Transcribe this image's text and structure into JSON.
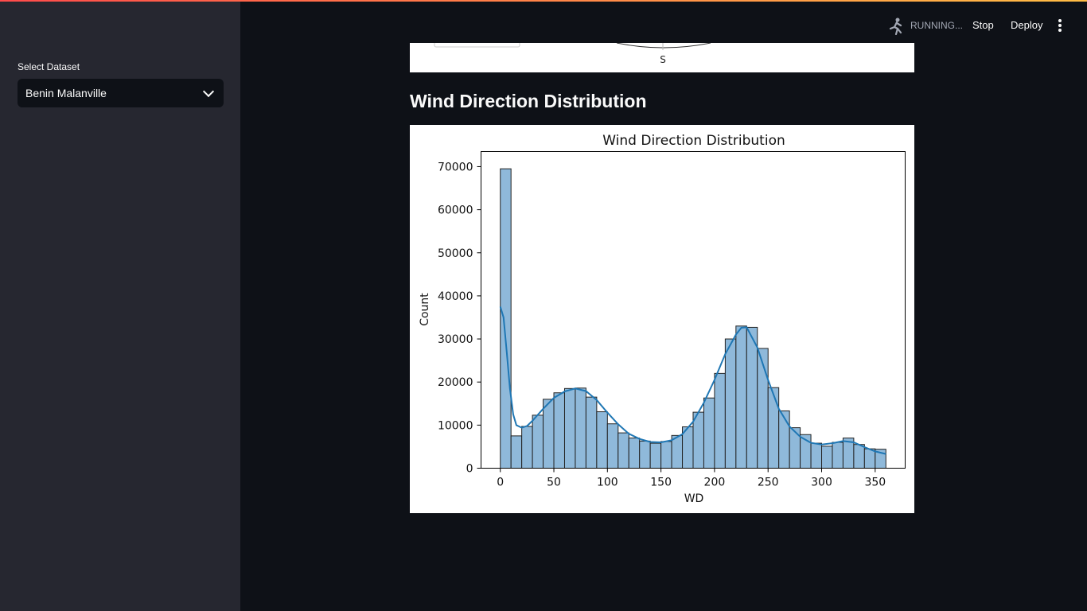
{
  "header": {
    "status": "RUNNING...",
    "stop_label": "Stop",
    "deploy_label": "Deploy",
    "menu_icon": "vertical-dots-icon",
    "status_icon": "running-person-icon"
  },
  "sidebar": {
    "select_label": "Select Dataset",
    "selected_dataset": "Benin Malanville"
  },
  "previous_chart": {
    "compass_label": "S"
  },
  "main": {
    "section_title": "Wind Direction Distribution"
  },
  "colors": {
    "background": "#0e1117",
    "sidebar": "#262730",
    "bar_fill": "#8fb9da",
    "kde_line": "#1f77b4"
  },
  "chart_data": {
    "type": "bar",
    "title": "Wind Direction Distribution",
    "xlabel": "WD",
    "ylabel": "Count",
    "xlim": [
      -18,
      378
    ],
    "ylim": [
      0,
      73500
    ],
    "xticks": [
      0,
      50,
      100,
      150,
      200,
      250,
      300,
      350
    ],
    "yticks": [
      0,
      10000,
      20000,
      30000,
      40000,
      50000,
      60000,
      70000
    ],
    "bin_width": 10,
    "bin_starts": [
      0,
      10,
      20,
      30,
      40,
      50,
      60,
      70,
      80,
      90,
      100,
      110,
      120,
      130,
      140,
      150,
      160,
      170,
      180,
      190,
      200,
      210,
      220,
      230,
      240,
      250,
      260,
      270,
      280,
      290,
      300,
      310,
      320,
      330,
      340,
      350
    ],
    "values": [
      69500,
      7500,
      9700,
      12300,
      16000,
      17500,
      18500,
      18600,
      16500,
      13100,
      10300,
      8200,
      7000,
      6300,
      5800,
      6200,
      7600,
      9600,
      13000,
      16300,
      22000,
      30000,
      33000,
      32700,
      27800,
      18700,
      13300,
      9400,
      7800,
      5800,
      5100,
      6000,
      7000,
      5500,
      4500,
      4400
    ],
    "kde": {
      "x": [
        0,
        3,
        6,
        9,
        12,
        15,
        20,
        25,
        30,
        40,
        50,
        60,
        70,
        80,
        90,
        100,
        110,
        120,
        130,
        140,
        150,
        160,
        170,
        180,
        190,
        200,
        210,
        220,
        225,
        230,
        240,
        250,
        260,
        270,
        280,
        290,
        300,
        310,
        320,
        330,
        340,
        350,
        360
      ],
      "y": [
        37500,
        35000,
        27000,
        18500,
        12500,
        10000,
        9400,
        9800,
        11000,
        13800,
        16300,
        17800,
        18500,
        17900,
        15800,
        12900,
        10200,
        8000,
        6800,
        6100,
        6000,
        6500,
        7900,
        10800,
        15200,
        20500,
        26500,
        31000,
        32600,
        32700,
        28000,
        20500,
        13800,
        9700,
        7300,
        5900,
        5500,
        5800,
        6300,
        6000,
        4900,
        3900,
        3300
      ]
    }
  }
}
